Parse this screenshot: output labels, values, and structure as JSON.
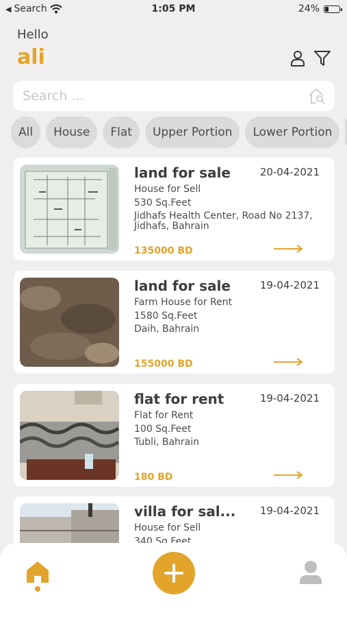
{
  "status_bar": {
    "back_app": "Search",
    "time": "1:05 PM",
    "battery": "24%",
    "battery_level": 0.24
  },
  "header": {
    "greeting": "Hello",
    "username": "ali"
  },
  "search": {
    "placeholder": "Search ..."
  },
  "categories": [
    "All",
    "House",
    "Flat",
    "Upper Portion",
    "Lower Portion"
  ],
  "listings": [
    {
      "title": "land for sale",
      "date": "20-04-2021",
      "type": "House for Sell",
      "area": "530 Sq.Feet",
      "location": "Jidhafs Health Center, Road No 2137, Jidhafs, Bahrain",
      "price": "135000 BD"
    },
    {
      "title": "land for sale",
      "date": "19-04-2021",
      "type": "Farm House for Rent",
      "area": "1580 Sq.Feet",
      "location": "Daih, Bahrain",
      "price": "155000 BD"
    },
    {
      "title": "flat for rent",
      "date": "19-04-2021",
      "type": "Flat for Rent",
      "area": "100 Sq.Feet",
      "location": "Tubli, Bahrain",
      "price": "180 BD"
    },
    {
      "title": "villa for sal...",
      "date": "19-04-2021",
      "type": "House for Sell",
      "area": "340 Sq.Feet",
      "location": "",
      "price": ""
    }
  ],
  "colors": {
    "accent": "#e2a42a",
    "background": "#f0eeef",
    "chip": "#dcdadb"
  },
  "icons": {
    "status": [
      "back-arrow-icon",
      "wifi-icon",
      "battery-icon"
    ],
    "header": [
      "user-icon",
      "filter-icon"
    ],
    "search": "home-search-icon",
    "nav": [
      "home-icon",
      "plus-icon",
      "user-icon"
    ]
  }
}
